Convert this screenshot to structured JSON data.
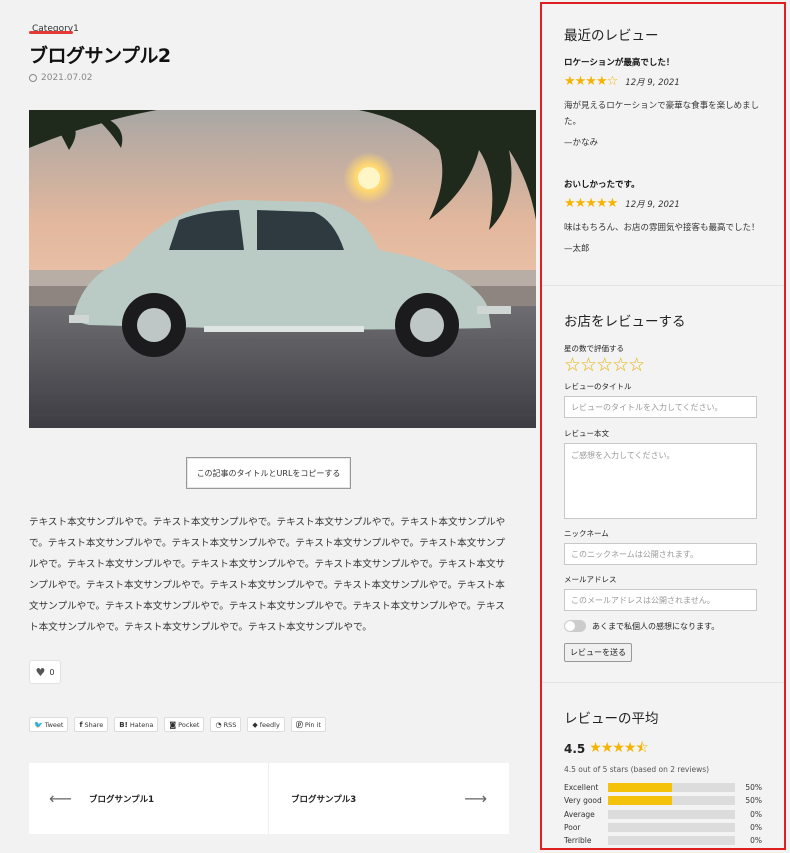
{
  "post": {
    "category": "Category1",
    "title": "ブログサンプル2",
    "date": "2021.07.02",
    "copy_button": "この記事のタイトルとURLをコピーする",
    "body_text": "テキスト本文サンプルやで。テキスト本文サンプルやで。テキスト本文サンプルやで。テキスト本文サンプルやで。テキスト本文サンプルやで。テキスト本文サンプルやで。テキスト本文サンプルやで。テキスト本文サンプルやで。テキスト本文サンプルやで。テキスト本文サンプルやで。テキスト本文サンプルやで。テキスト本文サンプルやで。テキスト本文サンプルやで。テキスト本文サンプルやで。テキスト本文サンプルやで。テキスト本文サンプルやで。テキスト本文サンプルやで。テキスト本文サンプルやで。テキスト本文サンプルやで。テキスト本文サンプルやで。テキスト本文サンプルやで。テキスト本文サンプルやで。",
    "like_count": "0"
  },
  "share": [
    {
      "icon": "twitter-icon",
      "glyph": "🐦",
      "label": "Tweet"
    },
    {
      "icon": "facebook-icon",
      "glyph": "f",
      "label": "Share"
    },
    {
      "icon": "hatena-icon",
      "glyph": "B!",
      "label": "Hatena"
    },
    {
      "icon": "pocket-icon",
      "glyph": "◙",
      "label": "Pocket"
    },
    {
      "icon": "rss-icon",
      "glyph": "◔",
      "label": "RSS"
    },
    {
      "icon": "feedly-icon",
      "glyph": "◆",
      "label": "feedly"
    },
    {
      "icon": "pinterest-icon",
      "glyph": "ⓟ",
      "label": "Pin it"
    }
  ],
  "pager": {
    "prev_label": "ブログサンプル1",
    "next_label": "ブログサンプル3"
  },
  "recent_reviews": {
    "title": "最近のレビュー",
    "items": [
      {
        "title": "ロケーションが最高でした！",
        "rating": 4,
        "date": "12月 9, 2021",
        "body": "海が見えるロケーションで豪華な食事を楽しめました。",
        "author": "—かなみ"
      },
      {
        "title": "おいしかったです。",
        "rating": 5,
        "date": "12月 9, 2021",
        "body": "味はもちろん、お店の雰囲気や接客も最高でした！",
        "author": "—太郎"
      }
    ]
  },
  "review_form": {
    "title": "お店をレビューする",
    "rating_label": "星の数で評価する",
    "review_title_label": "レビューのタイトル",
    "review_title_placeholder": "レビューのタイトルを入力してください。",
    "review_body_label": "レビュー本文",
    "review_body_placeholder": "ご感想を入力してください。",
    "nickname_label": "ニックネーム",
    "nickname_placeholder": "このニックネームは公開されます。",
    "email_label": "メールアドレス",
    "email_placeholder": "このメールアドレスは公開されません。",
    "consent_label": "あくまで私個人の感想になります。",
    "consent_checked": false,
    "submit_label": "レビューを送る"
  },
  "average": {
    "title": "レビューの平均",
    "score": "4.5",
    "rating": 4.5,
    "summary": "4.5 out of 5 stars (based on 2 reviews)",
    "breakdown": [
      {
        "label": "Excellent",
        "percent": 50,
        "percent_text": "50%"
      },
      {
        "label": "Very good",
        "percent": 50,
        "percent_text": "50%"
      },
      {
        "label": "Average",
        "percent": 0,
        "percent_text": "0%"
      },
      {
        "label": "Poor",
        "percent": 0,
        "percent_text": "0%"
      },
      {
        "label": "Terrible",
        "percent": 0,
        "percent_text": "0%"
      }
    ]
  },
  "colors": {
    "accent_red": "#e02020",
    "star": "#f4b400",
    "bar": "#f4c10b"
  }
}
